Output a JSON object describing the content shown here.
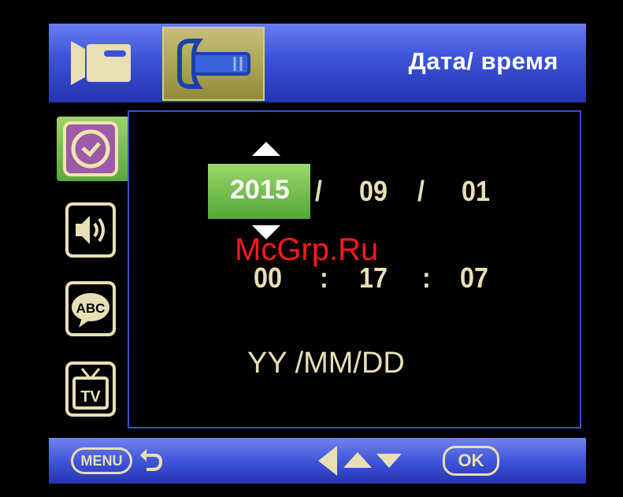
{
  "header": {
    "title": "Дата/ время"
  },
  "date": {
    "year": "2015",
    "sep1": "/",
    "month": "09",
    "sep2": "/",
    "day": "01"
  },
  "time": {
    "hour": "00",
    "sep1": ":",
    "minute": "17",
    "sep2": ":",
    "second": "07"
  },
  "format": "YY /MM/DD",
  "watermark": "McGrp.Ru",
  "footer": {
    "menu_label": "MENU",
    "ok_label": "OK"
  },
  "icons": [
    "video-camera-icon",
    "wrench-icon",
    "clock-icon",
    "speaker-icon",
    "abc-bubble-icon",
    "tv-icon",
    "back-arrow-icon",
    "left-arrow-icon",
    "up-arrow-icon",
    "down-arrow-icon"
  ],
  "colors": {
    "header_blue": "#3b52d8",
    "selected_green": "#5aa83a",
    "text_cream": "#e8dfb4",
    "setup_tab_olive": "#a7a04f",
    "watermark_red": "#ff1a1a"
  }
}
